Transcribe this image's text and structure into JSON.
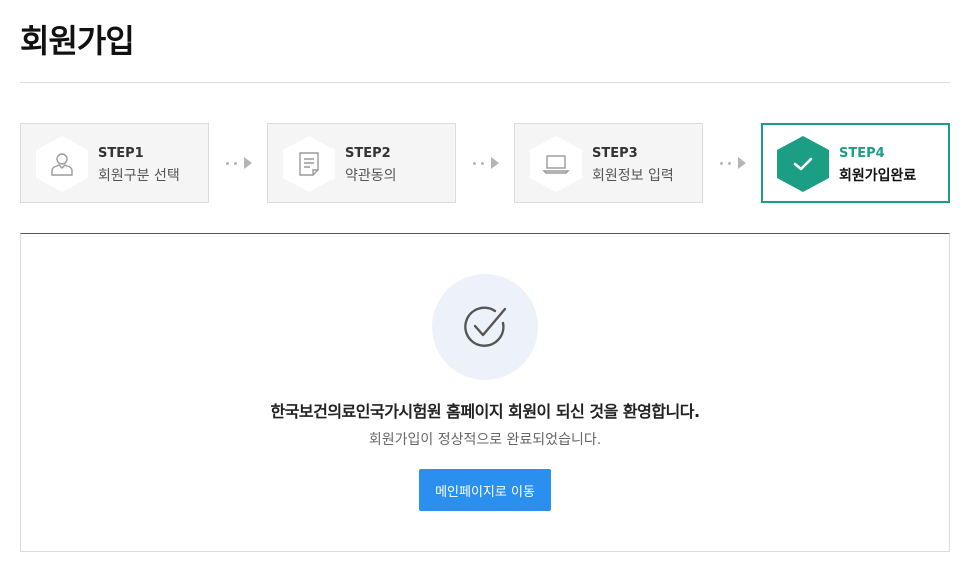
{
  "page": {
    "title": "회원가입"
  },
  "steps": [
    {
      "num": "STEP1",
      "label": "회원구분 선택",
      "icon": "user-icon",
      "active": false
    },
    {
      "num": "STEP2",
      "label": "약관동의",
      "icon": "document-icon",
      "active": false
    },
    {
      "num": "STEP3",
      "label": "회원정보 입력",
      "icon": "laptop-icon",
      "active": false
    },
    {
      "num": "STEP4",
      "label": "회원가입완료",
      "icon": "check-icon",
      "active": true
    }
  ],
  "completion": {
    "icon": "check-circle-icon",
    "message": "한국보건의료인국가시험원 홈페이지 회원이 되신 것을 환영합니다.",
    "sub_message": "회원가입이 정상적으로 완료되었습니다.",
    "button_label": "메인페이지로 이동"
  },
  "colors": {
    "accent": "#1b9e83",
    "button": "#2b8ff0",
    "circle_bg": "#edf2fa"
  }
}
